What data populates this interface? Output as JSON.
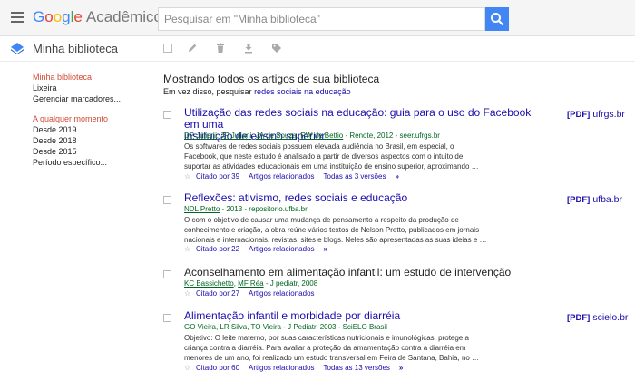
{
  "header": {
    "logo_google": "Google",
    "logo_product": "Acadêmico",
    "search_placeholder": "Pesquisar em \"Minha biblioteca\""
  },
  "library": {
    "title": "Minha biblioteca"
  },
  "sidebar": {
    "items": [
      {
        "label": "Minha biblioteca",
        "active": true
      },
      {
        "label": "Lixeira"
      },
      {
        "label": "Gerenciar marcadores..."
      }
    ],
    "time_heading": "A qualquer momento",
    "time_items": [
      {
        "label": "Desde 2019"
      },
      {
        "label": "Desde 2018"
      },
      {
        "label": "Desde 2015"
      },
      {
        "label": "Período específico..."
      }
    ]
  },
  "main": {
    "showing": "Mostrando todos os artigos de sua biblioteca",
    "instead_prefix": "Em vez disso, pesquisar",
    "instead_link": "redes sociais na educação"
  },
  "results": [
    {
      "title_line1": "Utilização das redes sociais na educação: guia para o uso do Facebook em uma",
      "title_line2": "instituição de ensino superior",
      "pdf_tag": "[PDF]",
      "pdf_host": "ufrgs.br",
      "authors_linked": [
        "DP Juliani",
        "JP Juliani",
        "JA de Souza",
        "RW de Bettio"
      ],
      "source": " - Renote, 2012 - seer.ufrgs.br",
      "snippet": [
        "Os softwares de redes sociais possuem elevada audiência no Brasil, em especial, o",
        "Facebook, que neste estudo é analisado a partir de diversos aspectos com o intuito de",
        "suportar as atividades educacionais em uma instituição de ensino superior, aproximando   …"
      ],
      "cited": "Citado por 39",
      "related": "Artigos relacionados",
      "versions": "Todas as 3 versões"
    },
    {
      "title_line1": "Reflexões: ativismo, redes sociais e educação",
      "pdf_tag": "[PDF]",
      "pdf_host": "ufba.br",
      "authors_linked": [
        "NDL Pretto"
      ],
      "source": " - 2013 - repositorio.ufba.br",
      "snippet": [
        "O com o objetivo de causar uma mudança de pensamento a respeito da produção de",
        "conhecimento e criação, a obra reúne vários textos de Nelson Pretto, publicados em jornais",
        "nacionais e internacionais, revistas, sites e blogs. Neles são apresentadas as suas ideias e   …"
      ],
      "cited": "Citado por 22",
      "related": "Artigos relacionados"
    },
    {
      "title_line1": "Aconselhamento em alimentação infantil: um estudo de intervenção",
      "authors_linked": [
        "KC Bassichetto",
        "MF Réa"
      ],
      "source": " - J pediatr, 2008",
      "cited": "Citado por 27",
      "related": "Artigos relacionados"
    },
    {
      "title_line1": "Alimentação infantil e morbidade por diarréia",
      "pdf_tag": "[PDF]",
      "pdf_host": "scielo.br",
      "authors_plain": "GO Vieira, LR Silva, TO Vieira - J Pediatr, 2003 - SciELO Brasil",
      "snippet": [
        "Objetivo: O leite materno, por suas características nutricionais e imunológicas, protege a",
        "criança contra a diarréia. Para avaliar a proteção da amamentação contra a diarréia em",
        "menores de um ano, foi realizado um estudo transversal em Feira de Santana, Bahia, no   …"
      ],
      "cited": "Citado por 60",
      "related": "Artigos relacionados",
      "versions": "Todas as 13 versões"
    }
  ],
  "colors": {
    "accent": "#4285f4",
    "link": "#1a0dab",
    "author_green": "#006621",
    "active_red": "#d14836"
  }
}
